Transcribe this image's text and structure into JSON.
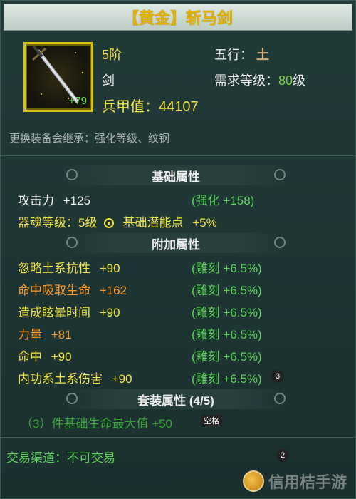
{
  "item": {
    "title": "【黄金】斩马剑",
    "icon": "sword-icon",
    "plus_level": "+79",
    "tier": "5阶",
    "weapon_type": "剑",
    "armor_value_label": "兵甲值：44107",
    "element_label": "五行：",
    "element_glyph": "土",
    "required_level_label": "需求等级：",
    "required_level_value": "80",
    "required_level_unit": "级",
    "inherit_note": "更换装备会继承：强化等级、纹钢"
  },
  "base_section": {
    "heading": "基础属性",
    "attack_label": "攻击力",
    "attack_value": "+125",
    "attack_bonus": "(强化 +158)",
    "soul_level": "器魂等级：5级",
    "potential": "基础潜能点",
    "potential_value": "+5%"
  },
  "extra_section": {
    "heading": "附加属性",
    "rows": [
      {
        "name": "忽略土系抗性",
        "value": "+90",
        "carve": "(雕刻 +6.5%)"
      },
      {
        "name": "命中吸取生命",
        "value": "+162",
        "carve": "(雕刻 +6.5%)"
      },
      {
        "name": "造成眩晕时间",
        "value": "+90",
        "carve": "(雕刻 +6.5%)"
      },
      {
        "name": "力量",
        "value": "+81",
        "carve": "(雕刻 +6.5%)"
      },
      {
        "name": "命中",
        "value": "+90",
        "carve": "(雕刻 +6.5%)"
      },
      {
        "name": "内功系土系伤害",
        "value": "+90",
        "carve": "(雕刻 +6.5%)"
      }
    ]
  },
  "set_section": {
    "heading": "套装属性 (4/5)",
    "bonus": "（3）件基础生命最大值 +50"
  },
  "trade": "交易渠道：不可交易",
  "badges": {
    "row_badge": "3",
    "space_badge": "空格",
    "bottom_badge": "2"
  },
  "watermark": "信用桔手游",
  "colors": {
    "background": "#1d3433",
    "title": "#e3b200",
    "yellow": "#f2e447",
    "orange": "#ff9a2b",
    "green": "#5ed25a"
  }
}
